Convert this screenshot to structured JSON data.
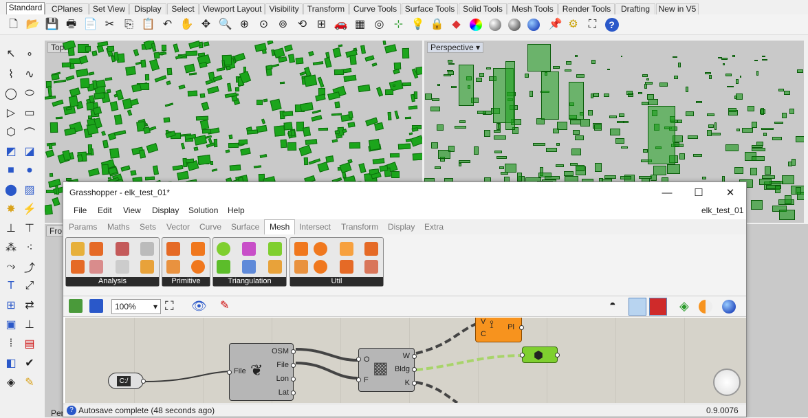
{
  "rhino": {
    "tabs": [
      "Standard",
      "CPlanes",
      "Set View",
      "Display",
      "Select",
      "Viewport Layout",
      "Visibility",
      "Transform",
      "Curve Tools",
      "Surface Tools",
      "Solid Tools",
      "Mesh Tools",
      "Render Tools",
      "Drafting",
      "New in V5"
    ],
    "active_tab": "Standard",
    "toolbar_icons": [
      "new-icon",
      "open-icon",
      "save-icon",
      "print-icon",
      "import-icon",
      "cut-icon",
      "copy-icon",
      "paste-icon",
      "undo-icon",
      "pan-icon",
      "rotate-view-icon",
      "zoom-icon",
      "zoom-window-icon",
      "zoom-extents-icon",
      "zoom-selected-icon",
      "four-view-icon",
      "car-icon",
      "grid-icon",
      "osnap-icon",
      "cplane-icon",
      "light-icon",
      "lock-icon",
      "layer-icon",
      "color-wheel-icon",
      "material-icon",
      "render-sphere-icon",
      "blue-sphere-icon",
      "pin-icon",
      "gear-icon",
      "filter-icon",
      "help-icon"
    ],
    "viewports": {
      "top_label": "Top",
      "perspective_label": "Perspective",
      "front_label": "Fro",
      "bottom_label": "Per"
    }
  },
  "grasshopper": {
    "title": "Grasshopper - elk_test_01*",
    "doc_name": "elk_test_01",
    "menu": [
      "File",
      "Edit",
      "View",
      "Display",
      "Solution",
      "Help"
    ],
    "tabs": [
      "Params",
      "Maths",
      "Sets",
      "Vector",
      "Curve",
      "Surface",
      "Mesh",
      "Intersect",
      "Transform",
      "Display",
      "Extra"
    ],
    "active_tab": "Mesh",
    "groups": [
      "Analysis",
      "Primitive",
      "Triangulation",
      "Util"
    ],
    "zoom": "100%",
    "status": "Autosave complete (48 seconds ago)",
    "version": "0.9.0076",
    "components": {
      "file_path": {
        "label": "C:/"
      },
      "osm": {
        "input": "File",
        "outputs": [
          "OSM",
          "File",
          "Lon",
          "Lat"
        ]
      },
      "elk": {
        "inputs": [
          "O",
          "F"
        ],
        "outputs": [
          "W",
          "Bldg",
          "K"
        ]
      },
      "pline": {
        "inputs": [
          "V",
          "C"
        ],
        "output": "Pl"
      }
    },
    "colors": {
      "accent": "#f7931e",
      "relay": "#7fcf2f",
      "model_green": "#1ca51c"
    }
  }
}
